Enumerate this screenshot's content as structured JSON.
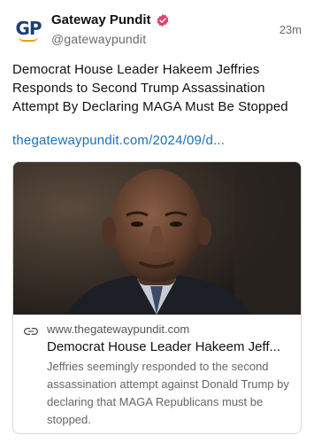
{
  "author": {
    "avatar_text": "GP",
    "display_name": "Gateway Pundit",
    "handle": "@gatewaypundit",
    "verified": true
  },
  "post": {
    "timestamp": "23m",
    "text": "Democrat House Leader Hakeem Jeffries Responds to Second Trump Assassination Attempt By Declaring MAGA Must Be Stopped",
    "link_text": "thegatewaypundit.com/2024/09/d..."
  },
  "link_card": {
    "domain": "www.thegatewaypundit.com",
    "title": "Democrat House Leader Hakeem Jeff...",
    "description": "Jeffries seemingly responded to the second assassination attempt against Donald Trump by declaring that MAGA Republicans must be stopped."
  },
  "colors": {
    "link": "#1d6fb8",
    "verified_badge": "#e4406f",
    "brand_navy": "#1d3f73",
    "brand_orange": "#e8a020"
  },
  "icons": [
    "verified-badge-icon",
    "link-icon"
  ]
}
